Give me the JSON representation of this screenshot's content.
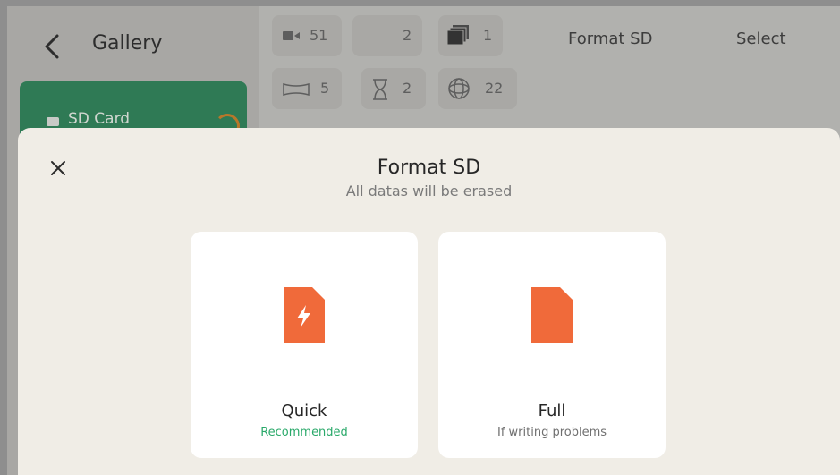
{
  "sidebar": {
    "title": "Gallery",
    "sd_card_label": "SD Card"
  },
  "filters": [
    {
      "icon": "video-icon",
      "count": "51"
    },
    {
      "icon": "blank-icon",
      "count": "2"
    },
    {
      "icon": "stack-icon",
      "count": "1"
    },
    {
      "icon": "panorama-icon",
      "count": "5"
    },
    {
      "icon": "hourglass-icon",
      "count": "2"
    },
    {
      "icon": "sphere-icon",
      "count": "22"
    }
  ],
  "header": {
    "format_link": "Format SD",
    "select_link": "Select"
  },
  "modal": {
    "title": "Format SD",
    "subtitle": "All datas will be erased",
    "options": [
      {
        "title": "Quick",
        "subtitle": "Recommended",
        "icon": "file-lightning-icon"
      },
      {
        "title": "Full",
        "subtitle": "If writing problems",
        "icon": "file-icon"
      }
    ]
  },
  "colors": {
    "accent": "#f06a3a",
    "recommended": "#2aa96a",
    "card": "#2f7a55"
  }
}
